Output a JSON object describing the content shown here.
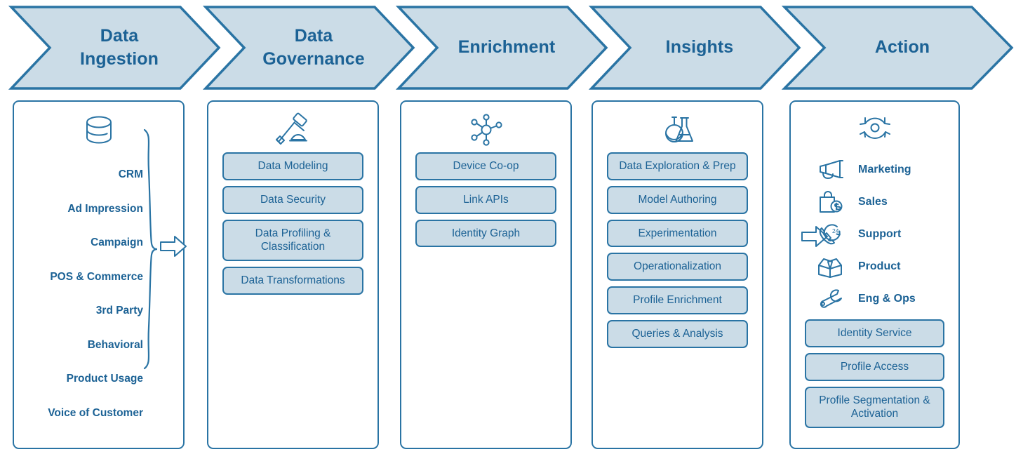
{
  "theme": {
    "accent": "#2a74a4",
    "text_blue": "#1c6295",
    "fill_light": "#cbdce7",
    "card_bg": "#ffffff",
    "page_bg": "#ffffff"
  },
  "stages": [
    {
      "id": "data-ingestion",
      "title_lines": [
        "Data",
        "Ingestion"
      ]
    },
    {
      "id": "data-governance",
      "title_lines": [
        "Data",
        "Governance"
      ]
    },
    {
      "id": "enrichment",
      "title_lines": [
        "Enrichment"
      ]
    },
    {
      "id": "insights",
      "title_lines": [
        "Insights"
      ]
    },
    {
      "id": "action",
      "title_lines": [
        "Action"
      ]
    }
  ],
  "columns": {
    "ingestion": {
      "icon": "database-icon",
      "sources": [
        "CRM",
        "Ad Impression",
        "Campaign",
        "POS & Commerce",
        "3rd Party",
        "Behavioral",
        "Product Usage",
        "Voice of Customer"
      ],
      "brace": "curly-brace",
      "arrow": "right-arrow-icon"
    },
    "governance": {
      "icon": "gavel-icon",
      "items": [
        {
          "label": "Data Modeling",
          "lines": 1
        },
        {
          "label": "Data Security",
          "lines": 1
        },
        {
          "label": "Data Profiling & Classification",
          "lines": 2
        },
        {
          "label": "Data Transformations",
          "lines": 1
        }
      ]
    },
    "enrichment": {
      "icon": "node-graph-icon",
      "items": [
        {
          "label": "Device Co-op",
          "lines": 1
        },
        {
          "label": "Link APIs",
          "lines": 1
        },
        {
          "label": "Identity Graph",
          "lines": 1
        }
      ]
    },
    "insights": {
      "icon": "flask-icon",
      "items": [
        {
          "label": "Data Exploration & Prep",
          "lines": 1
        },
        {
          "label": "Model Authoring",
          "lines": 1
        },
        {
          "label": "Experimentation",
          "lines": 1
        },
        {
          "label": "Operationalization",
          "lines": 1
        },
        {
          "label": "Profile Enrichment",
          "lines": 1
        },
        {
          "label": "Queries & Analysis",
          "lines": 1
        }
      ]
    },
    "action": {
      "icon": "sync-cycle-icon",
      "arrow": "right-arrow-icon",
      "channels": [
        {
          "label": "Marketing",
          "icon": "megaphone-icon"
        },
        {
          "label": "Sales",
          "icon": "shopping-bag-dollar-icon"
        },
        {
          "label": "Support",
          "icon": "phone-24h-icon"
        },
        {
          "label": "Product",
          "icon": "open-box-icon"
        },
        {
          "label": "Eng & Ops",
          "icon": "wrench-icon"
        }
      ],
      "items": [
        {
          "label": "Identity Service",
          "lines": 1
        },
        {
          "label": "Profile Access",
          "lines": 1
        },
        {
          "label": "Profile Segmentation & Activation",
          "lines": 2
        }
      ]
    }
  }
}
